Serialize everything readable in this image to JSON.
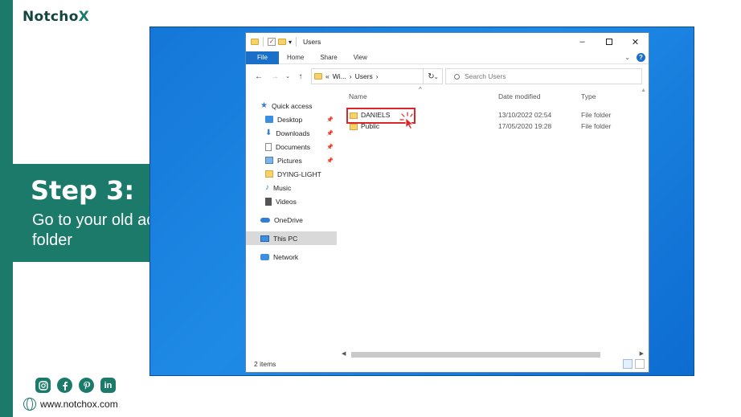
{
  "brand": {
    "logo_main": "Notcho",
    "logo_accent": "X"
  },
  "step": {
    "title": "Step 3:",
    "description": "Go to your old account folder"
  },
  "footer": {
    "social_icons": [
      "instagram-icon",
      "facebook-icon",
      "pinterest-icon",
      "linkedin-icon"
    ],
    "linkedin_text": "in",
    "website": "www.notchox.com"
  },
  "explorer": {
    "title": "Users",
    "ribbon_tabs": [
      "File",
      "Home",
      "Share",
      "View"
    ],
    "address": {
      "prefix": "«",
      "parts": [
        "Wi...",
        "›",
        "Users",
        "›"
      ]
    },
    "search_placeholder": "Search Users",
    "sidebar": {
      "quick_access": "Quick access",
      "pinned": [
        "Desktop",
        "Downloads",
        "Documents",
        "Pictures"
      ],
      "others": [
        "DYING-LIGHT",
        "Music",
        "Videos"
      ],
      "onedrive": "OneDrive",
      "this_pc": "This PC",
      "network": "Network"
    },
    "columns": {
      "name": "Name",
      "date": "Date modified",
      "type": "Type"
    },
    "rows": [
      {
        "name": "DANIELS",
        "date": "13/10/2022 02:54",
        "type": "File folder",
        "highlighted": true
      },
      {
        "name": "Public",
        "date": "17/05/2020 19:28",
        "type": "File folder",
        "highlighted": false
      }
    ],
    "status": "2 items"
  },
  "colors": {
    "brand_green": "#1c7a6b",
    "desktop_blue": "#1477d8",
    "highlight_red": "#d9262a",
    "file_tab_blue": "#1a6fc9"
  }
}
